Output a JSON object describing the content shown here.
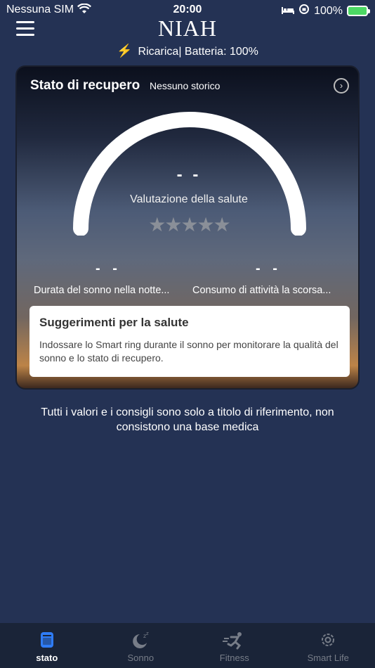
{
  "status_bar": {
    "carrier": "Nessuna SIM",
    "time": "20:00",
    "battery": "100%"
  },
  "header": {
    "logo": "NIAH",
    "charge_status": "Ricarica| Batteria: 100%"
  },
  "card": {
    "title": "Stato di recupero",
    "subtitle": "Nessuno storico",
    "score": "- -",
    "evaluation_label": "Valutazione della salute",
    "stars": "★★★★★",
    "sleep_value": "- -",
    "sleep_label": "Durata del sonno nella notte...",
    "activity_value": "- -",
    "activity_label": "Consumo di attività la scorsa..."
  },
  "tips": {
    "title": "Suggerimenti per la salute",
    "text": "Indossare lo Smart ring durante il sonno per monitorare la qualità del sonno e lo stato di recupero."
  },
  "disclaimer": "Tutti i valori e i consigli sono solo a titolo di riferimento, non consistono una base medica",
  "tabs": [
    {
      "label": "stato",
      "icon": "status-icon"
    },
    {
      "label": "Sonno",
      "icon": "sleep-icon"
    },
    {
      "label": "Fitness",
      "icon": "fitness-icon"
    },
    {
      "label": "Smart Life",
      "icon": "gear-icon"
    }
  ],
  "colors": {
    "background": "#243254",
    "accent": "#2f7cf6",
    "charge_bolt": "#3ed64b"
  }
}
